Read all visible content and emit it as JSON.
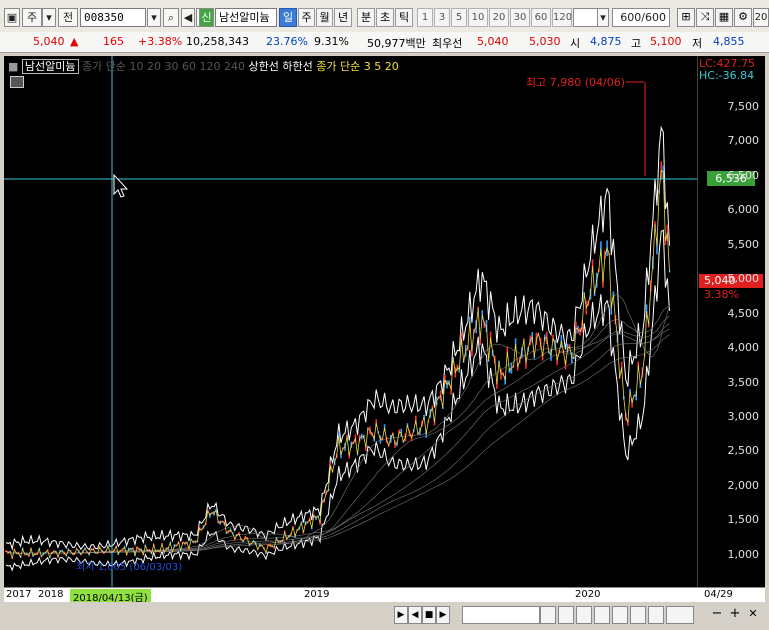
{
  "toolbar": {
    "market": "주",
    "jeon": "전",
    "code": "008350",
    "sin": "신",
    "name": "남선알미늄",
    "periods": [
      "일",
      "주",
      "월",
      "년"
    ],
    "active_period": "일",
    "intraday": [
      "분",
      "초",
      "틱"
    ],
    "numbers": [
      "1",
      "3",
      "5",
      "10",
      "20",
      "30",
      "60",
      "120"
    ],
    "count": "600/600",
    "right_num": "20"
  },
  "info": {
    "price": "5,040",
    "change": "165",
    "change_pct": "+3.38%",
    "volume": "10,258,343",
    "turnover_pct": "23.76%",
    "ratio": "9.31%",
    "amount": "50,977백만",
    "best_label": "최우선",
    "best_ask": "5,040",
    "best_bid": "5,030",
    "open_label": "시",
    "open": "4,875",
    "high_label": "고",
    "high": "5,100",
    "low_label": "저",
    "low": "4,855"
  },
  "chart": {
    "legend_name": "남선알미늄",
    "legend_items": [
      "종가",
      "단순",
      "10",
      "20",
      "30",
      "60",
      "120",
      "240",
      "상한선",
      "하한선"
    ],
    "close_simple_label": "종가 단순 3 5 20",
    "high_annotation": "최고 7,980 (04/06)",
    "low_annotation": "최저 1,005 (06/03/03)",
    "lc": "LC:427.75",
    "hc": "HC:-36.84",
    "crosshair_value": "6,536",
    "current_price": "5,040",
    "current_pct": "3.38%",
    "y_ticks": [
      "7,500",
      "7,000",
      "6,500",
      "6,000",
      "5,500",
      "5,000",
      "4,500",
      "4,000",
      "3,500",
      "3,000",
      "2,500",
      "2,000",
      "1,500",
      "1,000"
    ],
    "x_labels": [
      "2017",
      "2018",
      "2018/04/13(금)",
      "2019",
      "2020",
      "04/29"
    ],
    "colors": {
      "up": "#ff3030",
      "down": "#3aa0ff",
      "crosshair": "#3cc8d8",
      "highlight": "#90e040"
    }
  },
  "chart_data": {
    "type": "line",
    "title": "",
    "ylim": [
      700,
      8000
    ],
    "x": [
      "2017-06",
      "2017-09",
      "2017-12",
      "2018-02",
      "2018-03",
      "2018-04",
      "2018-06",
      "2018-09",
      "2018-10",
      "2018-11",
      "2018-12",
      "2019-01",
      "2019-03",
      "2019-04",
      "2019-06",
      "2019-07",
      "2019-09",
      "2019-11",
      "2019-12",
      "2020-01",
      "2020-02",
      "2020-03",
      "2020-04",
      "2020-04-06",
      "2020-04-29"
    ],
    "series": [
      {
        "values": [
          1020,
          1060,
          1070,
          1180,
          1650,
          1320,
          1080,
          1560,
          2550,
          2600,
          2800,
          2650,
          2900,
          3400,
          4450,
          3600,
          4100,
          3900,
          4800,
          5400,
          3000,
          3700,
          6500,
          7980,
          5040
        ]
      }
    ]
  }
}
